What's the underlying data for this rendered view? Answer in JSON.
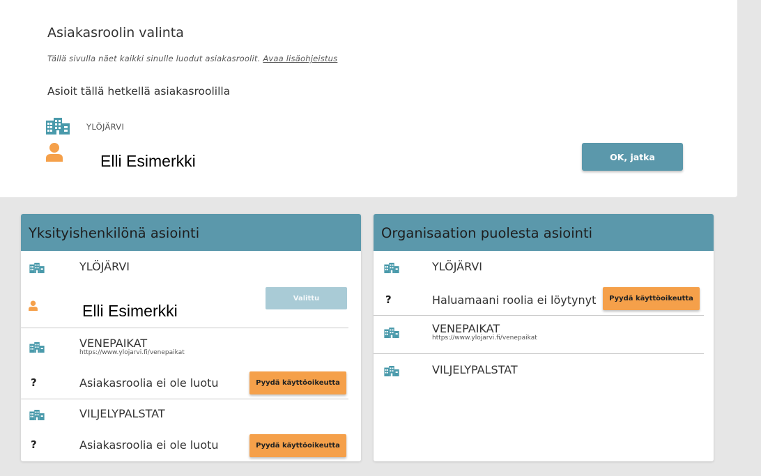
{
  "top": {
    "title": "Asiakasroolin valinta",
    "desc_text": "Tällä sivulla näet kaikki sinulle luodut asiakasroolit.",
    "desc_link": "Avaa lisäohjeistus",
    "current_label": "Asioit tällä hetkellä asiakasroolilla",
    "current_org": "YLÖJÄRVI",
    "current_name": "Elli Esimerkki",
    "ok_button": "OK, jatka"
  },
  "left_panel": {
    "title": "Yksityishenkilönä asiointi",
    "org1": {
      "name": "YLÖJÄRVI",
      "person": "Elli Esimerkki",
      "button": "Valittu"
    },
    "org2": {
      "name": "VENEPAIKAT",
      "url": "https://www.ylojarvi.fi/venepaikat",
      "status": "Asiakasroolia ei ole luotu",
      "button": "Pyydä käyttöoikeutta"
    },
    "org3": {
      "name": "VILJELYPALSTAT",
      "status": "Asiakasroolia ei ole luotu",
      "button": "Pyydä käyttöoikeutta"
    }
  },
  "right_panel": {
    "title": "Organisaation puolesta asiointi",
    "org1": {
      "name": "YLÖJÄRVI",
      "status": "Haluamaani roolia ei löytynyt",
      "button": "Pyydä käyttöoikeutta"
    },
    "org2": {
      "name": "VENEPAIKAT",
      "url": "https://www.ylojarvi.fi/venepaikat"
    },
    "org3": {
      "name": "VILJELYPALSTAT"
    }
  },
  "icons": {
    "building": "building-icon",
    "person": "person-icon",
    "unknown": "question-icon"
  },
  "colors": {
    "accent": "#5b98ab",
    "orange": "#f5a04a",
    "selected": "#a9cbd6",
    "icon_teal": "#4a9aab"
  }
}
